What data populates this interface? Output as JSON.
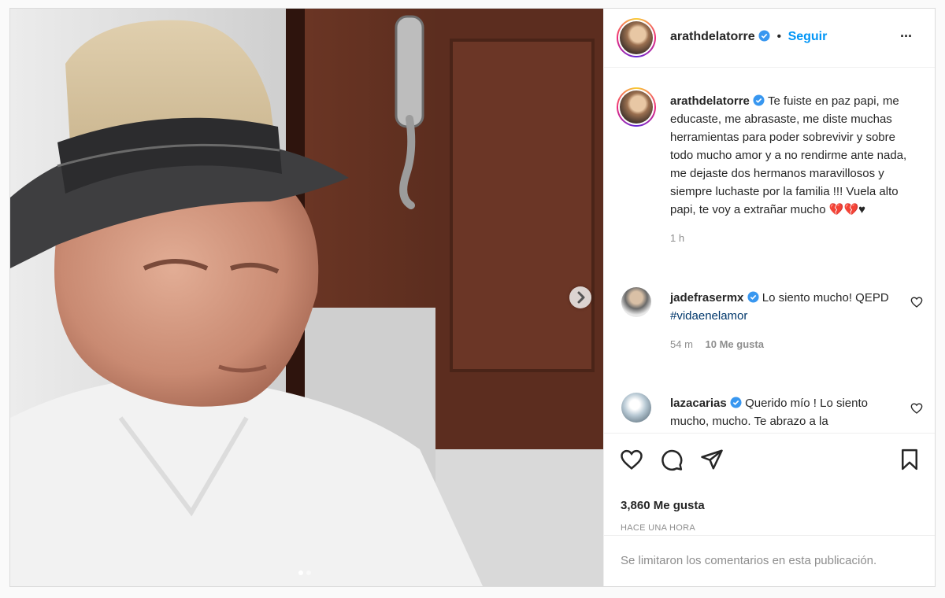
{
  "post": {
    "username": "arathdelatorre",
    "follow_label": "Seguir",
    "dot": "•",
    "more": "···",
    "caption": "Te fuiste en paz papi, me educaste, me abrasaste, me diste muchas herramientas para poder sobrevivir y sobre todo mucho amor y a no rendirme ante nada, me dejaste dos hermanos maravillosos y siempre luchaste por la familia !!! Vuela alto papi, te voy a extrañar mucho 💔💔♥",
    "caption_time": "1 h"
  },
  "comments": [
    {
      "username": "jadefrasermx",
      "text": "Lo siento mucho! QEPD",
      "hashtag": "#vidaenelamor",
      "time": "54 m",
      "likes": "10 Me gusta"
    },
    {
      "username": "lazacarias",
      "text": "Querido mío ! Lo siento mucho, mucho. Te abrazo a la"
    }
  ],
  "actions": {
    "likes": "3,860 Me gusta",
    "time_ago": "HACE UNA HORA"
  },
  "footer": {
    "limited": "Se limitaron los comentarios en esta publicación."
  },
  "carousel": {
    "total_slides": 2,
    "active_slide": 1
  },
  "colors": {
    "link": "#0095f6",
    "hashtag": "#00376b",
    "verified": "#3897f0"
  }
}
